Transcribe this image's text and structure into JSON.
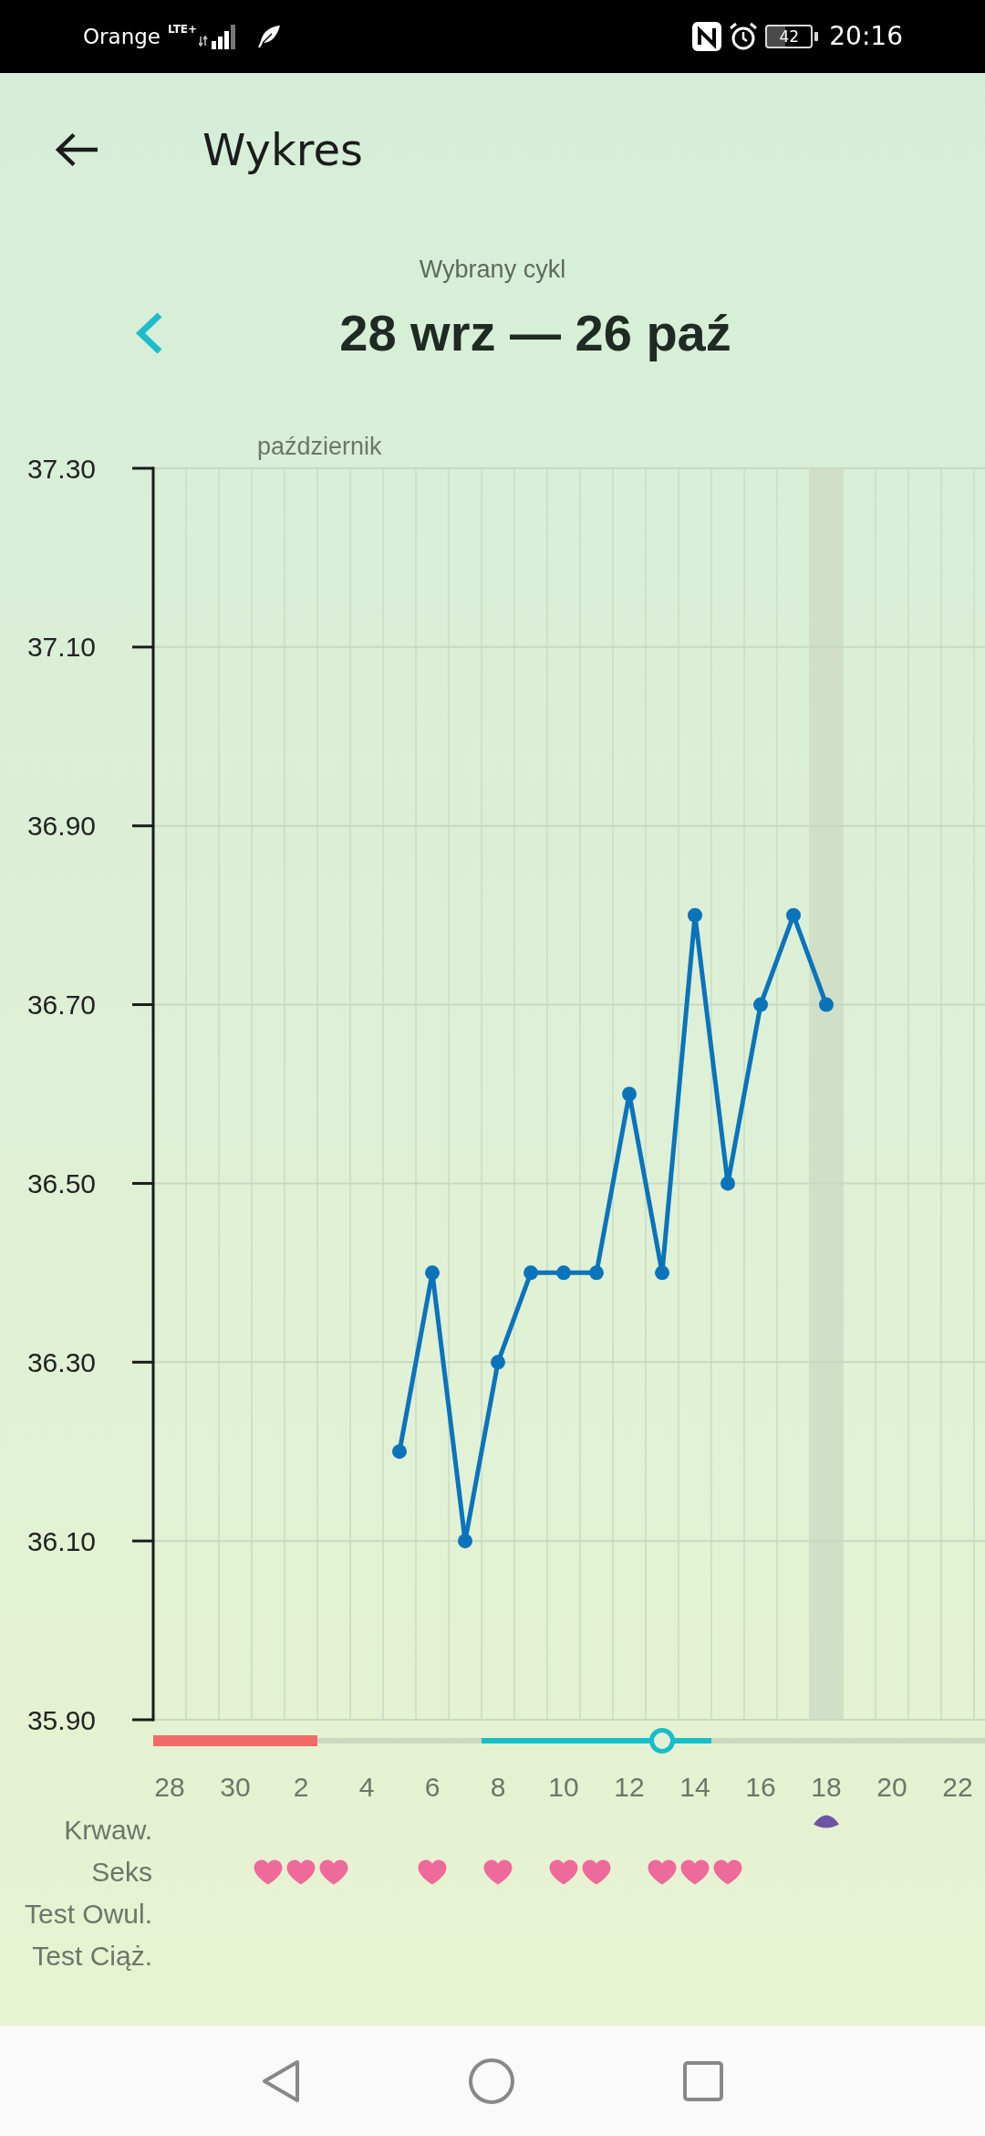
{
  "status_bar": {
    "carrier": "Orange",
    "network": "LTE+",
    "battery": "42",
    "time": "20:16"
  },
  "app_bar": {
    "title": "Wykres"
  },
  "cycle": {
    "caption": "Wybrany cykl",
    "range": "28 wrz — 26 paź"
  },
  "chart": {
    "month_label": "październik",
    "chart_data": {
      "type": "line",
      "grid": true,
      "categories": [
        "28",
        null,
        "30",
        null,
        "2",
        null,
        "4",
        null,
        "6",
        null,
        "8",
        null,
        "10",
        null,
        "12",
        null,
        "14",
        null,
        "16",
        null,
        "18",
        null,
        "20",
        null,
        "22"
      ],
      "series": [
        {
          "color": "#0a74bb",
          "marker": "circle",
          "values": [
            null,
            null,
            null,
            null,
            null,
            null,
            null,
            36.2,
            36.4,
            36.1,
            36.3,
            36.4,
            36.4,
            36.4,
            36.6,
            36.4,
            36.8,
            36.5,
            36.7,
            36.8,
            36.7,
            null,
            null,
            null,
            null
          ]
        }
      ],
      "ylim": [
        35.9,
        37.3
      ],
      "yticks": [
        {
          "value": 37.3,
          "label": "37.30"
        },
        {
          "value": 37.1,
          "label": "37.10"
        },
        {
          "value": 36.9,
          "label": "36.90"
        },
        {
          "value": 36.7,
          "label": "36.70"
        },
        {
          "value": 36.5,
          "label": "36.50"
        },
        {
          "value": 36.3,
          "label": "36.30"
        },
        {
          "value": 36.1,
          "label": "36.10"
        },
        {
          "value": 35.9,
          "label": "35.90"
        }
      ],
      "bands": [
        {
          "axis": "x",
          "from": "18",
          "to": "18"
        }
      ]
    },
    "cycle_days": [
      {
        "kind": "period"
      },
      {
        "kind": "period"
      },
      {
        "kind": "period"
      },
      {
        "kind": "period"
      },
      {
        "kind": "period"
      },
      {
        "kind": "plain"
      },
      {
        "kind": "plain"
      },
      {
        "kind": "plain"
      },
      {
        "kind": "plain"
      },
      {
        "kind": "plain"
      },
      {
        "kind": "fertile"
      },
      {
        "kind": "fertile"
      },
      {
        "kind": "fertile"
      },
      {
        "kind": "fertile"
      },
      {
        "kind": "fertile"
      },
      {
        "kind": "ovulation"
      },
      {
        "kind": "fertile"
      },
      {
        "kind": "plain"
      },
      {
        "kind": "plain"
      },
      {
        "kind": "plain"
      },
      {
        "kind": "plain"
      },
      {
        "kind": "plain"
      },
      {
        "kind": "plain"
      },
      {
        "kind": "plain"
      },
      {
        "kind": "plain"
      }
    ],
    "rows": [
      {
        "label": "Krwaw.",
        "kind": "drop",
        "marks": [
          false,
          false,
          false,
          false,
          false,
          false,
          false,
          false,
          false,
          false,
          false,
          false,
          false,
          false,
          false,
          false,
          false,
          false,
          false,
          false,
          true,
          false,
          false,
          false,
          false
        ]
      },
      {
        "label": "Seks",
        "kind": "heart",
        "marks": [
          false,
          false,
          false,
          true,
          true,
          true,
          false,
          false,
          true,
          false,
          true,
          false,
          true,
          true,
          false,
          true,
          true,
          true,
          false,
          false,
          false,
          false,
          false,
          false,
          false
        ]
      },
      {
        "label": "Test Owul."
      },
      {
        "label": "Test Ciąż."
      }
    ]
  }
}
